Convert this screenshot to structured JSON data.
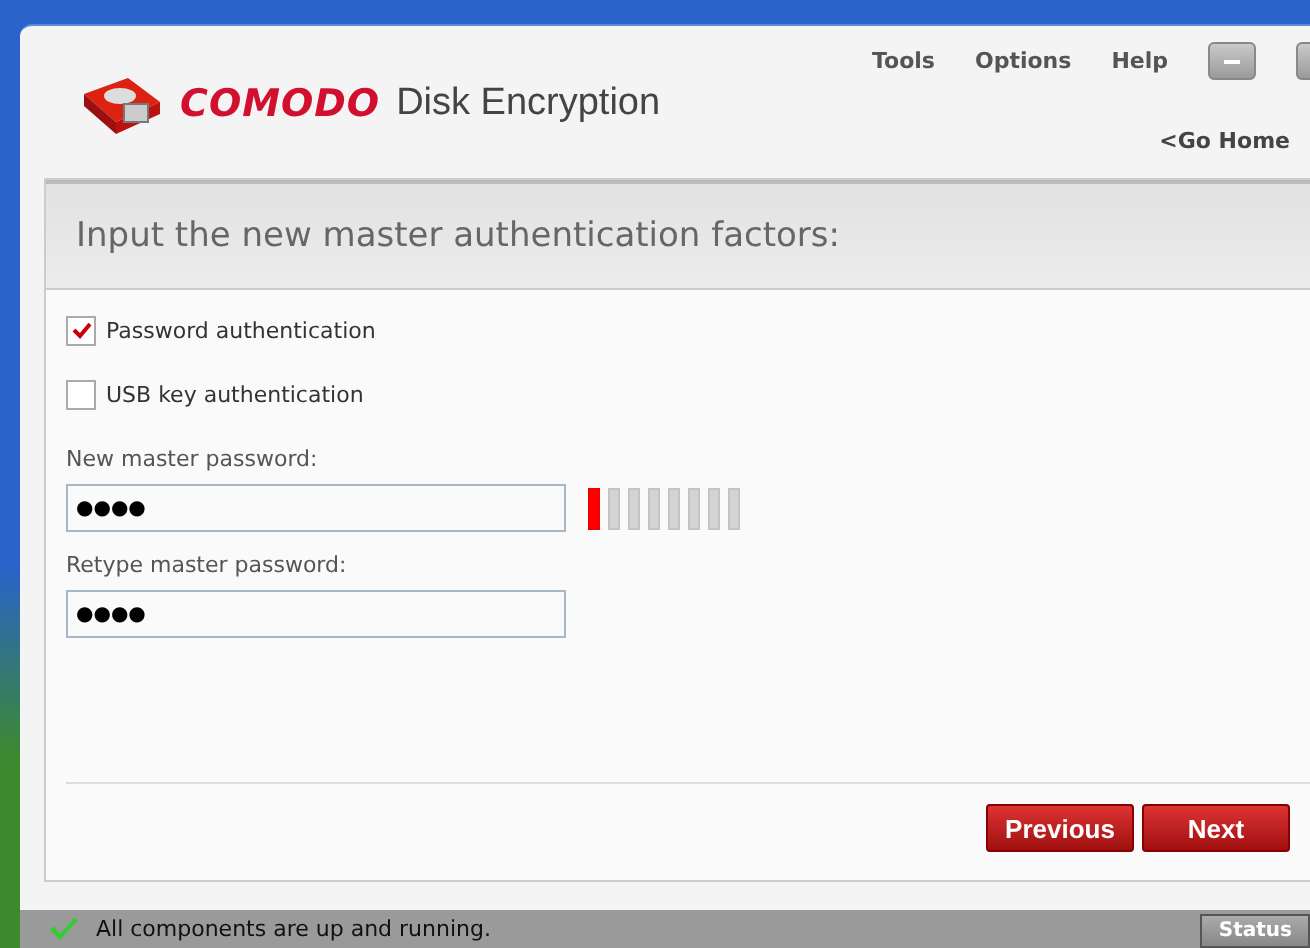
{
  "app": {
    "brand": "COMODO",
    "product": "Disk Encryption"
  },
  "menu": [
    "Tools",
    "Options",
    "Help"
  ],
  "go_home": "<Go Home",
  "panel": {
    "title": "Input the new master authentication factors:"
  },
  "options": [
    {
      "label": "Password authentication",
      "checked": true
    },
    {
      "label": "USB key authentication",
      "checked": false
    }
  ],
  "fields": [
    {
      "label": "New master password:",
      "value": "●●●●",
      "strength": {
        "level": 0.125
      }
    },
    {
      "label": "Retype master password:",
      "value": "●●●●"
    }
  ],
  "buttons": [
    "Previous",
    "Next"
  ],
  "status_bar": {
    "message": "All components are up and running.",
    "button": "Status"
  }
}
